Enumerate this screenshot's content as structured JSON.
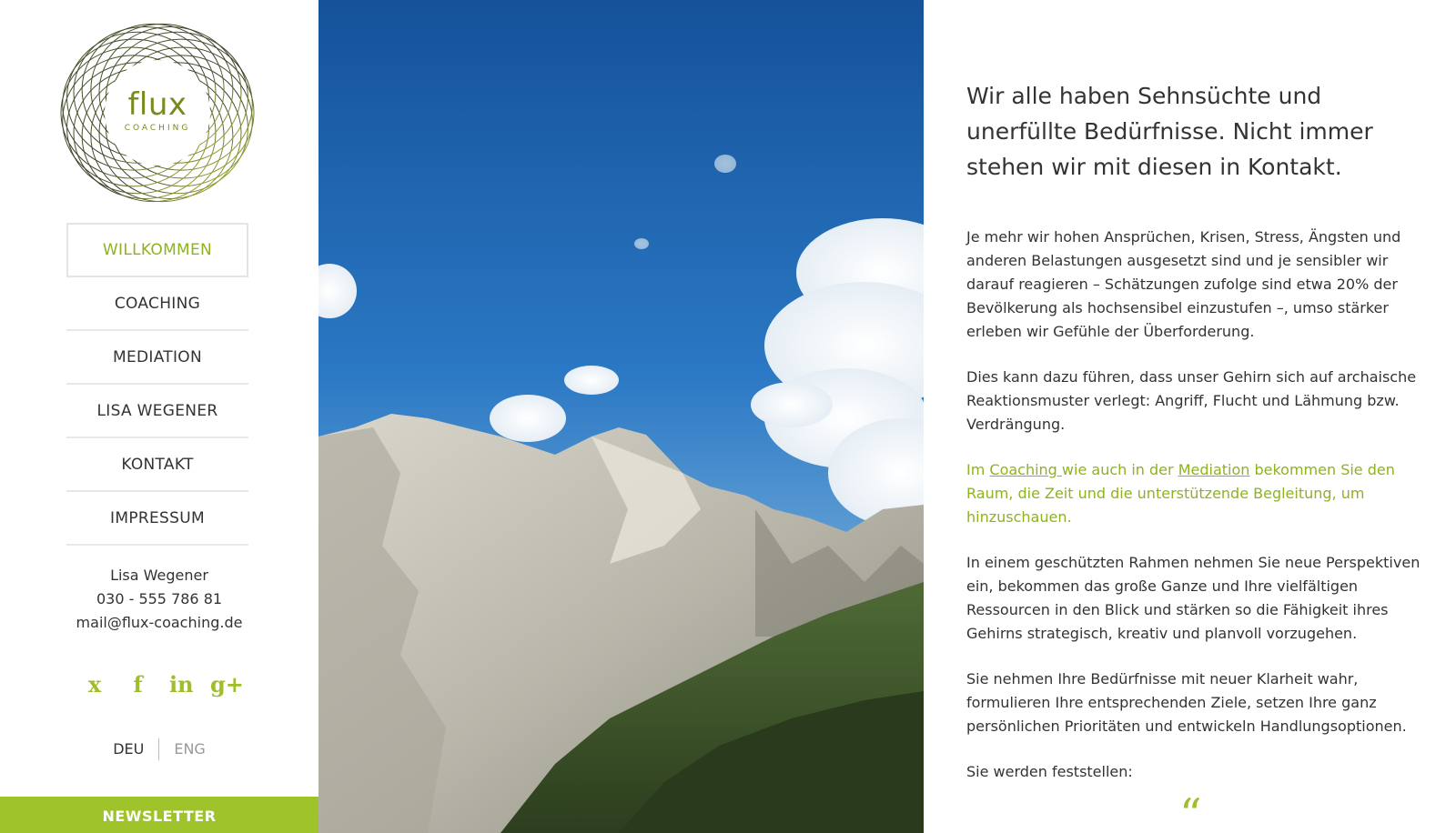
{
  "brand": {
    "name": "flux",
    "subtitle": "COACHING",
    "accent_color": "#9fc32b"
  },
  "nav": {
    "items": [
      {
        "label": "WILLKOMMEN",
        "active": true
      },
      {
        "label": "COACHING",
        "active": false
      },
      {
        "label": "MEDIATION",
        "active": false
      },
      {
        "label": "LISA WEGENER",
        "active": false
      },
      {
        "label": "KONTAKT",
        "active": false
      },
      {
        "label": "IMPRESSUM",
        "active": false
      }
    ]
  },
  "contact": {
    "name": "Lisa Wegener",
    "phone": "030 - 555 786 81",
    "email": "mail@flux-coaching.de"
  },
  "social": {
    "icons": [
      "xing-icon",
      "facebook-icon",
      "linkedin-icon",
      "google-plus-icon"
    ],
    "glyphs": [
      "x",
      "f",
      "in",
      "g+"
    ]
  },
  "language": {
    "current": "DEU",
    "other": "ENG"
  },
  "newsletter": {
    "label": "NEWSLETTER"
  },
  "main": {
    "headline": "Wir alle haben Sehnsüchte und unerfüllte Bedürfnisse. Nicht immer stehen wir mit diesen in Kontakt.",
    "paragraph1": "Je mehr wir hohen Ansprüchen, Krisen, Stress, Ängsten und anderen Belastungen ausgesetzt sind und je sensibler wir darauf reagieren – Schätzungen zufolge sind etwa 20% der Bevölkerung als hochsensibel einzustufen –, umso stärker erleben wir Gefühle der Überforderung.",
    "paragraph2": "Dies kann dazu führen, dass unser Gehirn sich auf archaische Reaktionsmuster verlegt: Angriff, Flucht und Lähmung bzw. Verdrängung.",
    "highlight": {
      "prefix": "Im ",
      "link1": "Coaching ",
      "middle": "wie auch in der ",
      "link2": "Mediation",
      "suffix": " bekommen Sie den Raum, die Zeit und die unterstützende Begleitung, um hinzuschauen."
    },
    "paragraph3": "In einem geschützten Rahmen nehmen Sie neue Perspektiven ein, bekommen das große Ganze und Ihre vielfältigen Ressourcen in den Blick und stärken so die Fähigkeit ihres Gehirns strategisch, kreativ und planvoll vorzugehen.",
    "paragraph4": "Sie nehmen Ihre Bedürfnisse mit neuer Klarheit wahr, formulieren Ihre entsprechenden Ziele, setzen Ihre ganz persönlichen Prioritäten und entwickeln Handlungsoptionen.",
    "paragraph5": "Sie werden feststellen:",
    "quote_mark": "“"
  }
}
